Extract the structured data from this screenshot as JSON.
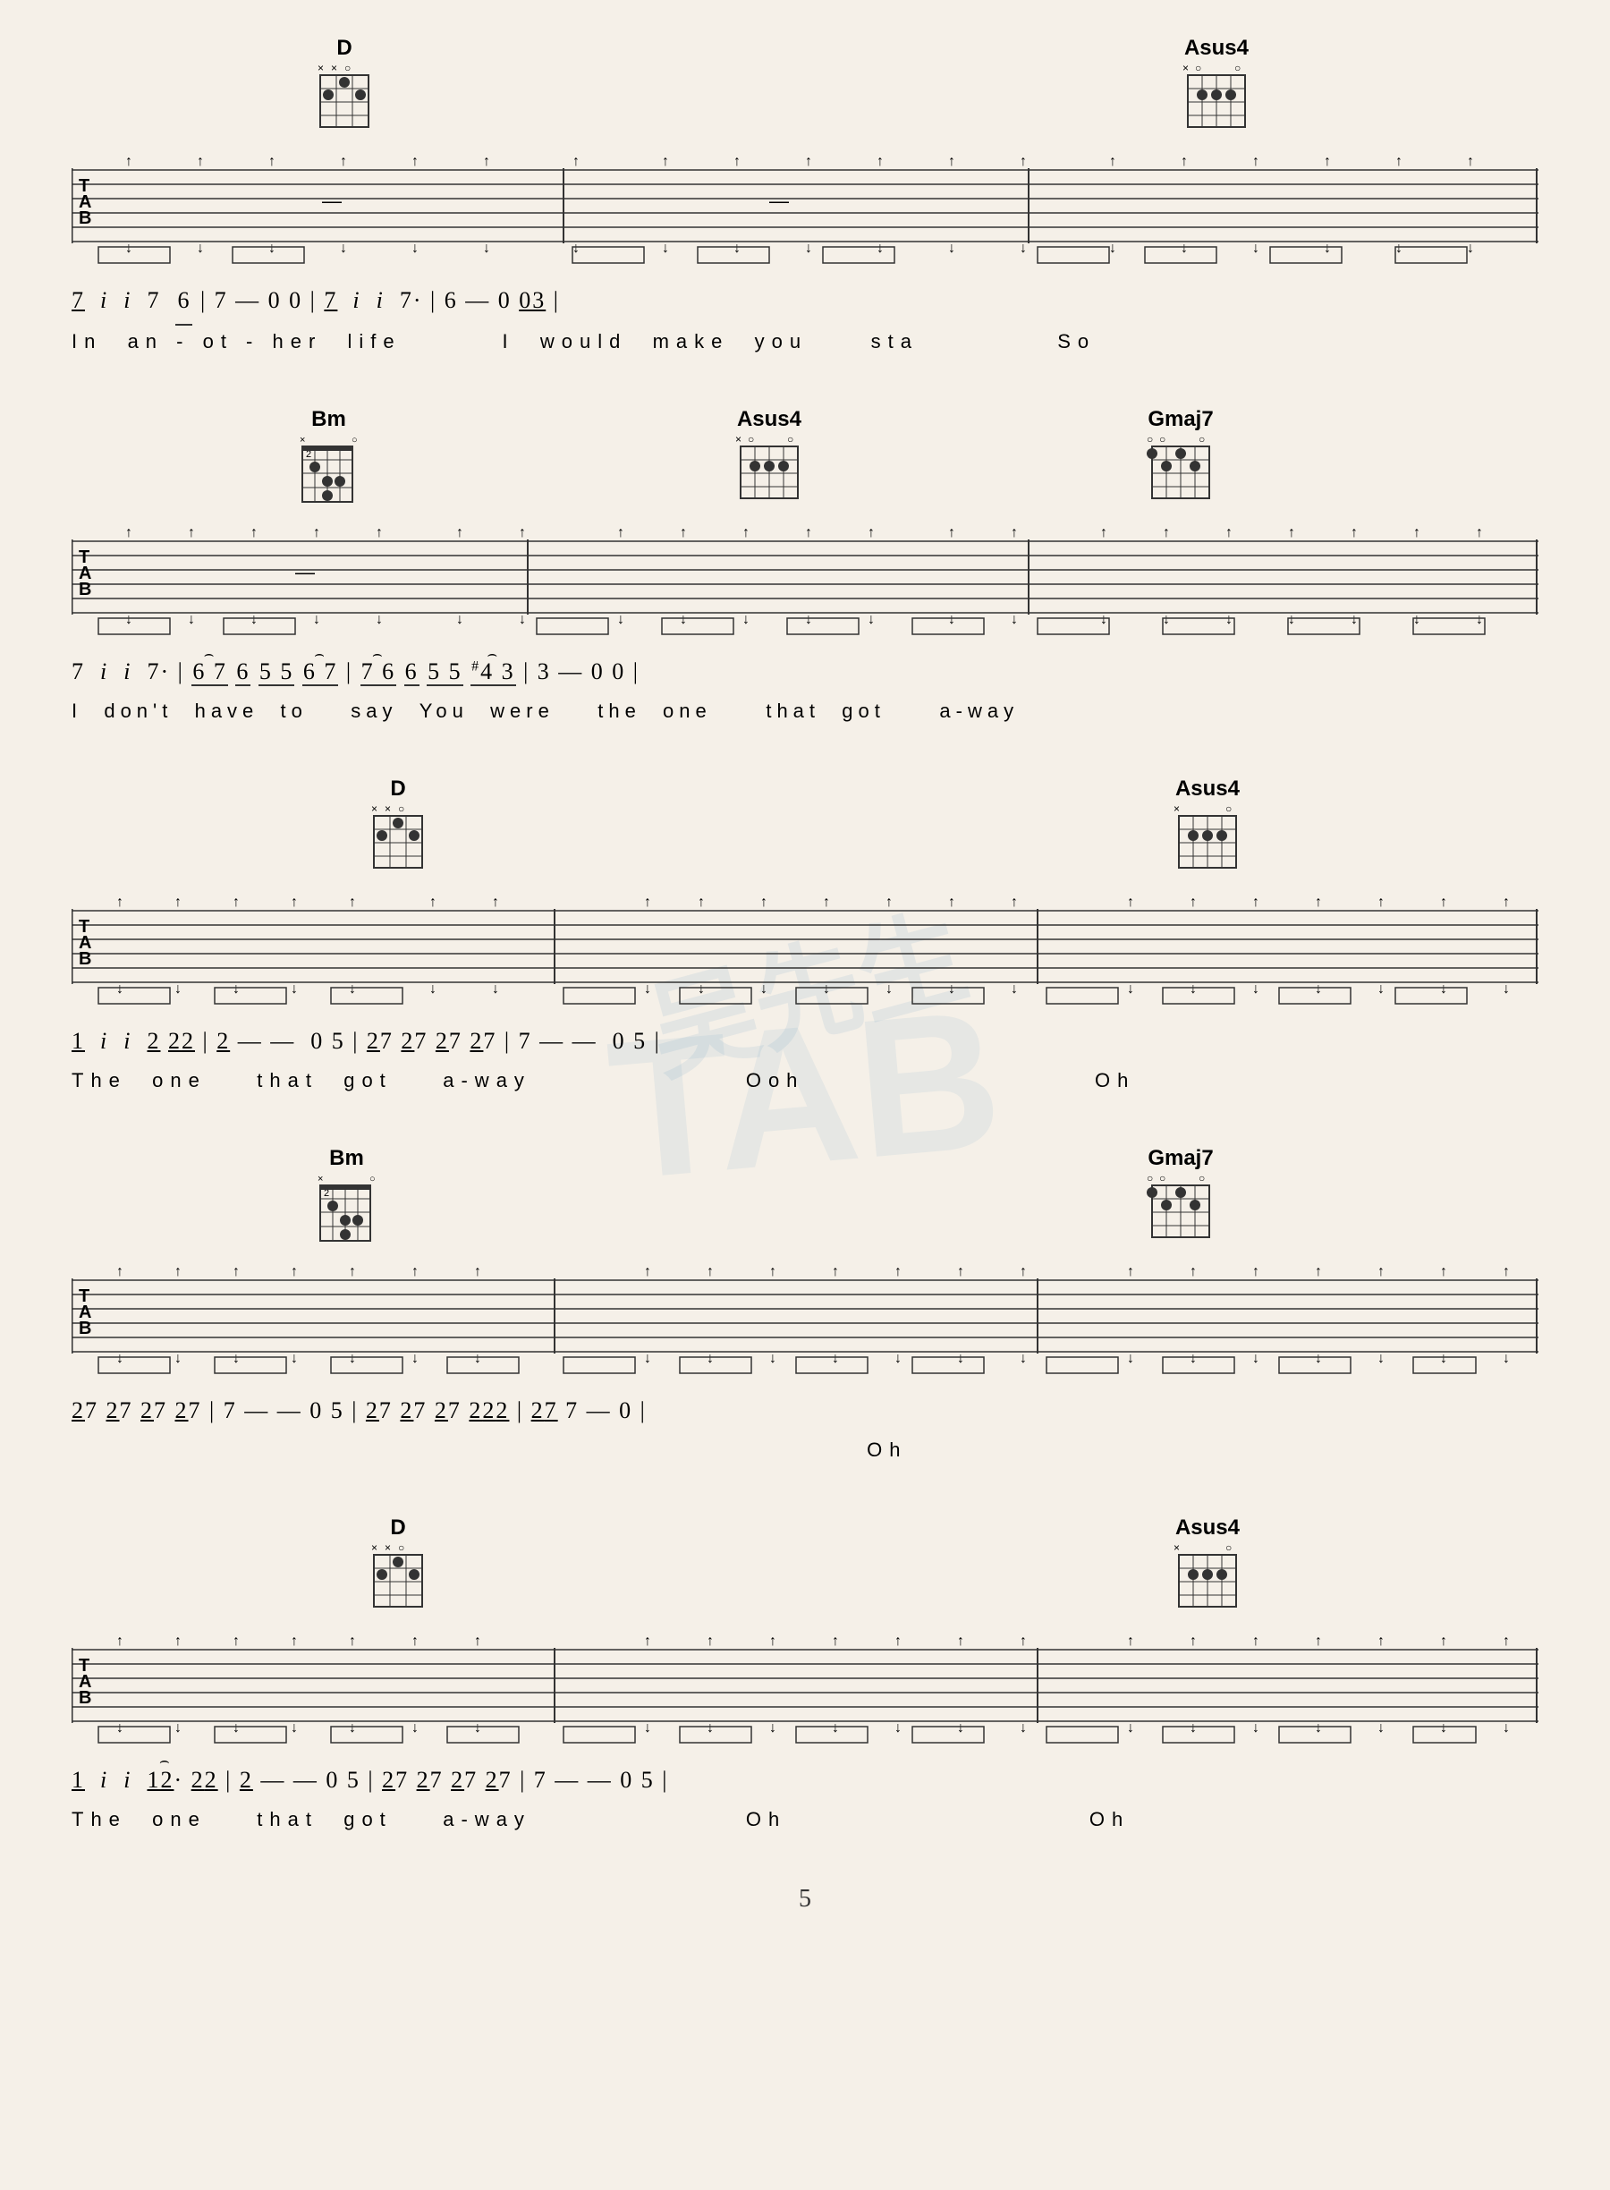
{
  "page": {
    "number": "5",
    "background_color": "#f5f0e8"
  },
  "watermark": {
    "symbol": "TAB",
    "chinese": "吴先生"
  },
  "sections": [
    {
      "id": "section1",
      "chords": [
        {
          "name": "D",
          "position_percent": 18,
          "fret_marker": "××○",
          "top_markers": "××○○"
        },
        {
          "name": "Asus4",
          "position_percent": 72,
          "fret_marker": "×○",
          "top_markers": "×○○○○"
        }
      ],
      "lyrics": "In an - ot - her life    I would make you sta    So",
      "notation": "7 i i 7 6̲|7 — 0 0 |7̲ i i 7· | 6 — 0 0̲3̲|"
    },
    {
      "id": "section2",
      "chords": [
        {
          "name": "Bm",
          "position_percent": 18,
          "fret_marker": "2fr",
          "top_markers": "×○○○"
        },
        {
          "name": "Asus4",
          "position_percent": 47,
          "fret_marker": "",
          "top_markers": "×○○○○"
        },
        {
          "name": "Gmaj7",
          "position_percent": 72,
          "fret_marker": "",
          "top_markers": "○○○○○"
        }
      ],
      "lyrics": "I don't have to say You were the one that got a-way",
      "notation": "7 i i 7· | 6̲7̲ 6̲ 5̲5̲ 6̲7̲|7̲6̲ 6̲ 5̲5̲ #4̲3̲|3 — 0 0 |"
    },
    {
      "id": "section3",
      "chords": [
        {
          "name": "D",
          "position_percent": 22,
          "fret_marker": "××○",
          "top_markers": "××○○"
        },
        {
          "name": "Asus4",
          "position_percent": 72,
          "fret_marker": "×○",
          "top_markers": "×○○○○"
        }
      ],
      "lyrics": "The one that got a-way         Ooh              Oh",
      "notation": "1̲ i i 2̲ 2̲2̲|2̲ — — 0 5 |2̲7 2̲7 2̲7 2̲7|7 — — 0 5|"
    },
    {
      "id": "section4",
      "chords": [
        {
          "name": "Bm",
          "position_percent": 18,
          "fret_marker": "2fr",
          "top_markers": "×○○○"
        },
        {
          "name": "Gmaj7",
          "position_percent": 72,
          "fret_marker": "",
          "top_markers": "○○○○○"
        }
      ],
      "lyrics": "                                    Oh",
      "notation": "2̲7 2̲7 2̲7 2̲7|7 — — 0 5 |2̲7 2̲7 2̲7 2̲2̲|2̲7̲ 7 — 0 |"
    },
    {
      "id": "section5",
      "chords": [
        {
          "name": "D",
          "position_percent": 22,
          "fret_marker": "××○",
          "top_markers": "××○○"
        },
        {
          "name": "Asus4",
          "position_percent": 72,
          "fret_marker": "×○",
          "top_markers": "×○○○○"
        }
      ],
      "lyrics": "The one that got a-way        Oh              Oh",
      "notation": "1̲ i i 1̲2·̲ 2̲2̲|2̲ — — 0 5 |2̲7 2̲7 2̲7 2̲7|7 — — 0 5|"
    }
  ]
}
